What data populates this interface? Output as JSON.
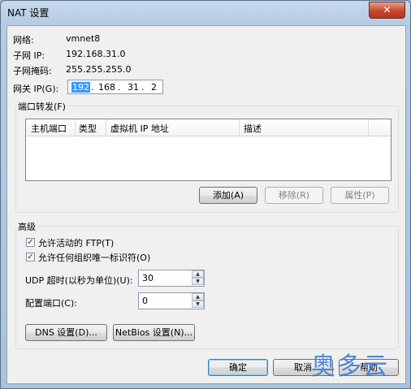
{
  "window": {
    "title": "NAT 设置",
    "close_label": "✕"
  },
  "info": {
    "network_label": "网络:",
    "network_value": "vmnet8",
    "subnet_ip_label": "子网 IP:",
    "subnet_ip_value": "192.168.31.0",
    "subnet_mask_label": "子网掩码:",
    "subnet_mask_value": "255.255.255.0",
    "gateway_label": "网关 IP(G):",
    "gateway_octets": [
      "192",
      "168",
      "31",
      "2"
    ]
  },
  "port_forwarding": {
    "title": "端口转发(F)",
    "columns": [
      "主机端口",
      "类型",
      "虚拟机 IP 地址",
      "描述"
    ],
    "add_label": "添加(A)",
    "remove_label": "移除(R)",
    "properties_label": "属性(P)"
  },
  "advanced": {
    "title": "高级",
    "allow_ftp_label": "允许活动的 FTP(T)",
    "allow_ftp_checked": true,
    "allow_oui_label": "允许任何组织唯一标识符(O)",
    "allow_oui_checked": true,
    "udp_timeout_label": "UDP 超时(以秒为单位)(U):",
    "udp_timeout_value": "30",
    "config_port_label": "配置端口(C):",
    "config_port_value": "0",
    "dns_button_label": "DNS 设置(D)...",
    "netbios_button_label": "NetBios 设置(N)..."
  },
  "footer": {
    "ok_label": "确定",
    "cancel_label": "取消",
    "help_label": "帮助"
  },
  "watermark": "奥多云"
}
